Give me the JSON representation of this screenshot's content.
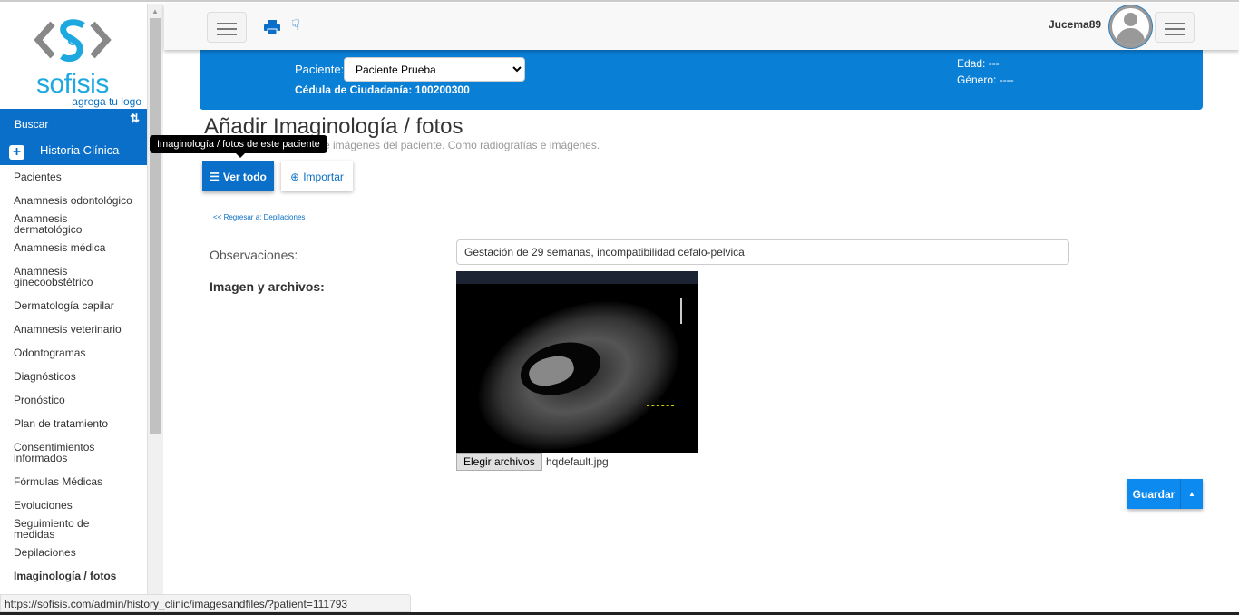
{
  "logo": {
    "brand": "sofisis",
    "tagline": "agrega tu logo"
  },
  "sidebar": {
    "search_label": "Buscar",
    "section_label": "Historia Clínica",
    "items": [
      {
        "label": "Pacientes"
      },
      {
        "label": "Anamnesis odontológico"
      },
      {
        "label": "Anamnesis dermatológico"
      },
      {
        "label": "Anamnesis médica"
      },
      {
        "label": "Anamnesis ginecoobstétrico"
      },
      {
        "label": "Dermatología capilar"
      },
      {
        "label": "Anamnesis veterinario"
      },
      {
        "label": "Odontogramas"
      },
      {
        "label": "Diagnósticos"
      },
      {
        "label": "Pronóstico"
      },
      {
        "label": "Plan de tratamiento"
      },
      {
        "label": "Consentimientos informados"
      },
      {
        "label": "Fórmulas Médicas"
      },
      {
        "label": "Evoluciones"
      },
      {
        "label": "Seguimiento de medidas"
      },
      {
        "label": "Depilaciones"
      },
      {
        "label": "Imaginología / fotos"
      }
    ]
  },
  "navbar": {
    "username": "Jucema89"
  },
  "patient": {
    "patient_label": "Paciente:",
    "patient_value": "Paciente Prueba",
    "id_text": "Cédula de Ciudadanía: 100200300",
    "age_text": "Edad: ---",
    "gender_text": "Género: ----"
  },
  "page": {
    "title": "Añadir Imaginología / fotos",
    "subtitle": "e imágenes del paciente. Como radiografías e imágenes.",
    "tooltip": "Imaginología / fotos de este paciente",
    "view_all": "Ver todo",
    "import": "Importar",
    "back_link": "<< Regresar a: Depilaciones"
  },
  "form": {
    "observations_label": "Observaciones:",
    "observations_value": "Gestación de 29 semanas, incompatibilidad cefalo-pelvica",
    "files_label": "Imagen y archivos:",
    "choose_files": "Elegir archivos",
    "file_name": "hqdefault.jpg",
    "save": "Guardar"
  },
  "status_url": "https://sofisis.com/admin/history_clinic/imagesandfiles/?patient=111793"
}
